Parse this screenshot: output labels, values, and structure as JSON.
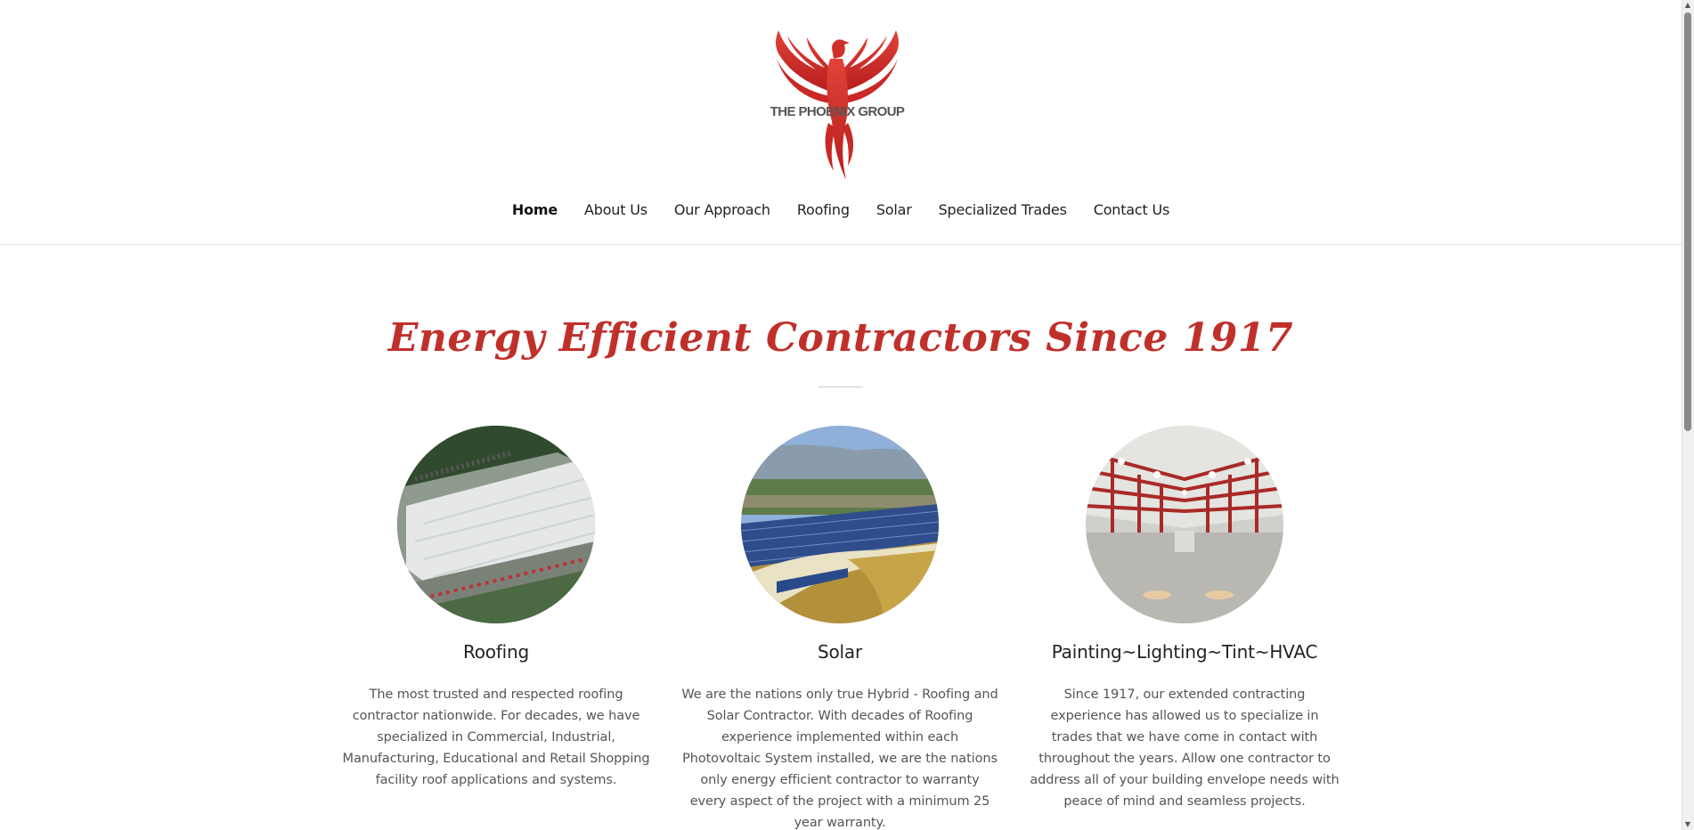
{
  "brand": {
    "logo_text": "THE PHOENIX GROUP",
    "accent_color": "#c0302b"
  },
  "nav": {
    "items": [
      {
        "label": "Home",
        "active": true
      },
      {
        "label": "About Us"
      },
      {
        "label": "Our Approach"
      },
      {
        "label": "Roofing"
      },
      {
        "label": "Solar"
      },
      {
        "label": "Specialized Trades"
      },
      {
        "label": "Contact Us"
      }
    ]
  },
  "hero": {
    "tagline": "Energy Efficient Contractors Since 1917"
  },
  "services": [
    {
      "title": "Roofing",
      "image": "aerial-warehouse-roof",
      "description": "The most trusted and respected roofing contractor nationwide. For decades, we have specialized in Commercial, Industrial, Manufacturing, Educational and Retail Shopping facility roof applications and systems."
    },
    {
      "title": "Solar",
      "image": "solar-panel-roof",
      "description": "We are the nations only true Hybrid - Roofing and Solar Contractor. With decades of Roofing experience implemented within each Photovoltaic System installed, we are the nations only energy efficient contractor to warranty every aspect of the project with a minimum 25 year warranty."
    },
    {
      "title": "Painting~Lighting~Tint~HVAC",
      "image": "warehouse-interior-lighting",
      "description": "Since 1917, our extended contracting experience has allowed us to specialize in trades that we have come in contact with throughout the years. Allow one contractor to address all of your building envelope needs with peace of mind and seamless projects."
    }
  ]
}
